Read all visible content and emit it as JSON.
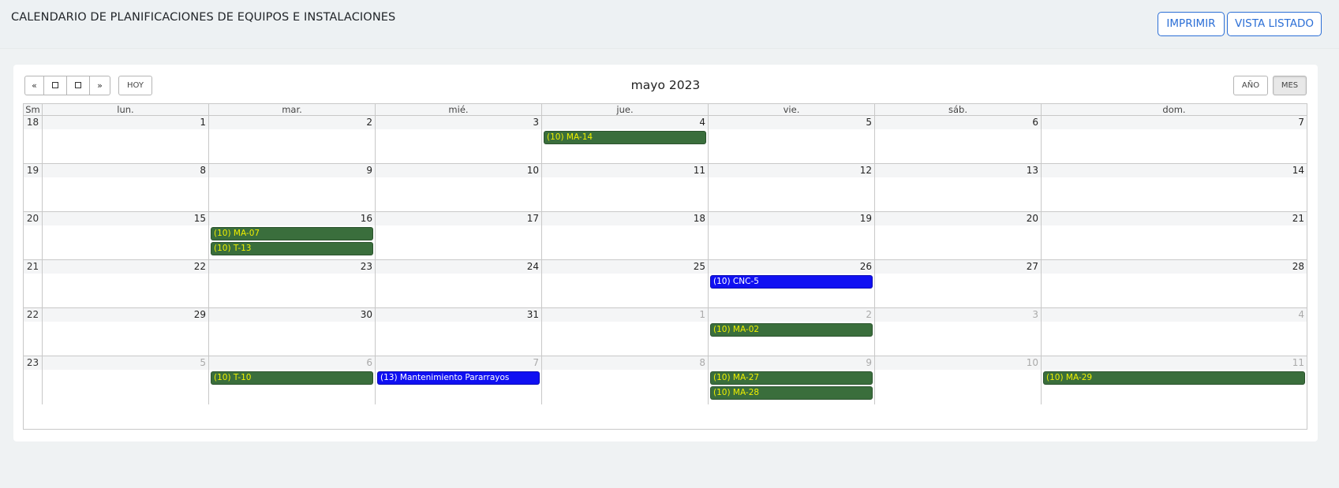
{
  "header": {
    "title": "CALENDARIO DE PLANIFICACIONES DE EQUIPOS E INSTALACIONES",
    "print_label": "IMPRIMIR",
    "list_view_label": "VISTA LISTADO"
  },
  "toolbar": {
    "prev_label": "«",
    "next_label": "»",
    "today_label": "HOY",
    "title": "mayo 2023",
    "year_label": "AÑO",
    "month_label": "MES",
    "month_active": true
  },
  "calendar": {
    "week_col_label": "Sm",
    "day_headers": [
      "lun.",
      "mar.",
      "mié.",
      "jue.",
      "vie.",
      "sáb.",
      "dom."
    ],
    "weeks": [
      {
        "wn": "18",
        "days": [
          "1",
          "2",
          "3",
          "4",
          "5",
          "6",
          "7"
        ],
        "other": [
          false,
          false,
          false,
          false,
          false,
          false,
          false
        ]
      },
      {
        "wn": "19",
        "days": [
          "8",
          "9",
          "10",
          "11",
          "12",
          "13",
          "14"
        ],
        "other": [
          false,
          false,
          false,
          false,
          false,
          false,
          false
        ]
      },
      {
        "wn": "20",
        "days": [
          "15",
          "16",
          "17",
          "18",
          "19",
          "20",
          "21"
        ],
        "other": [
          false,
          false,
          false,
          false,
          false,
          false,
          false
        ]
      },
      {
        "wn": "21",
        "days": [
          "22",
          "23",
          "24",
          "25",
          "26",
          "27",
          "28"
        ],
        "other": [
          false,
          false,
          false,
          false,
          false,
          false,
          false
        ]
      },
      {
        "wn": "22",
        "days": [
          "29",
          "30",
          "31",
          "1",
          "2",
          "3",
          "4"
        ],
        "other": [
          false,
          false,
          false,
          true,
          true,
          true,
          true
        ]
      },
      {
        "wn": "23",
        "days": [
          "5",
          "6",
          "7",
          "8",
          "9",
          "10",
          "11"
        ],
        "other": [
          true,
          true,
          true,
          true,
          true,
          true,
          true
        ]
      }
    ],
    "events": [
      {
        "week": 0,
        "day": 3,
        "slot": 0,
        "label": "(10) MA-14",
        "color": "green"
      },
      {
        "week": 2,
        "day": 1,
        "slot": 0,
        "label": "(10) MA-07",
        "color": "green"
      },
      {
        "week": 2,
        "day": 1,
        "slot": 1,
        "label": "(10) T-13",
        "color": "green"
      },
      {
        "week": 3,
        "day": 4,
        "slot": 0,
        "label": "(10) CNC-5",
        "color": "blue"
      },
      {
        "week": 4,
        "day": 4,
        "slot": 0,
        "label": "(10) MA-02",
        "color": "green"
      },
      {
        "week": 5,
        "day": 1,
        "slot": 0,
        "label": "(10) T-10",
        "color": "green"
      },
      {
        "week": 5,
        "day": 2,
        "slot": 0,
        "label": "(13) Mantenimiento Pararrayos",
        "color": "blue"
      },
      {
        "week": 5,
        "day": 4,
        "slot": 0,
        "label": "(10) MA-27",
        "color": "green"
      },
      {
        "week": 5,
        "day": 4,
        "slot": 1,
        "label": "(10) MA-28",
        "color": "green"
      },
      {
        "week": 5,
        "day": 6,
        "slot": 0,
        "label": "(10) MA-29",
        "color": "green"
      }
    ]
  },
  "colors": {
    "event_green": "#3a6e3c",
    "event_green_text": "#f0f000",
    "event_blue": "#1010f2",
    "event_blue_text": "#ffffff",
    "accent": "#2c6fd6"
  }
}
